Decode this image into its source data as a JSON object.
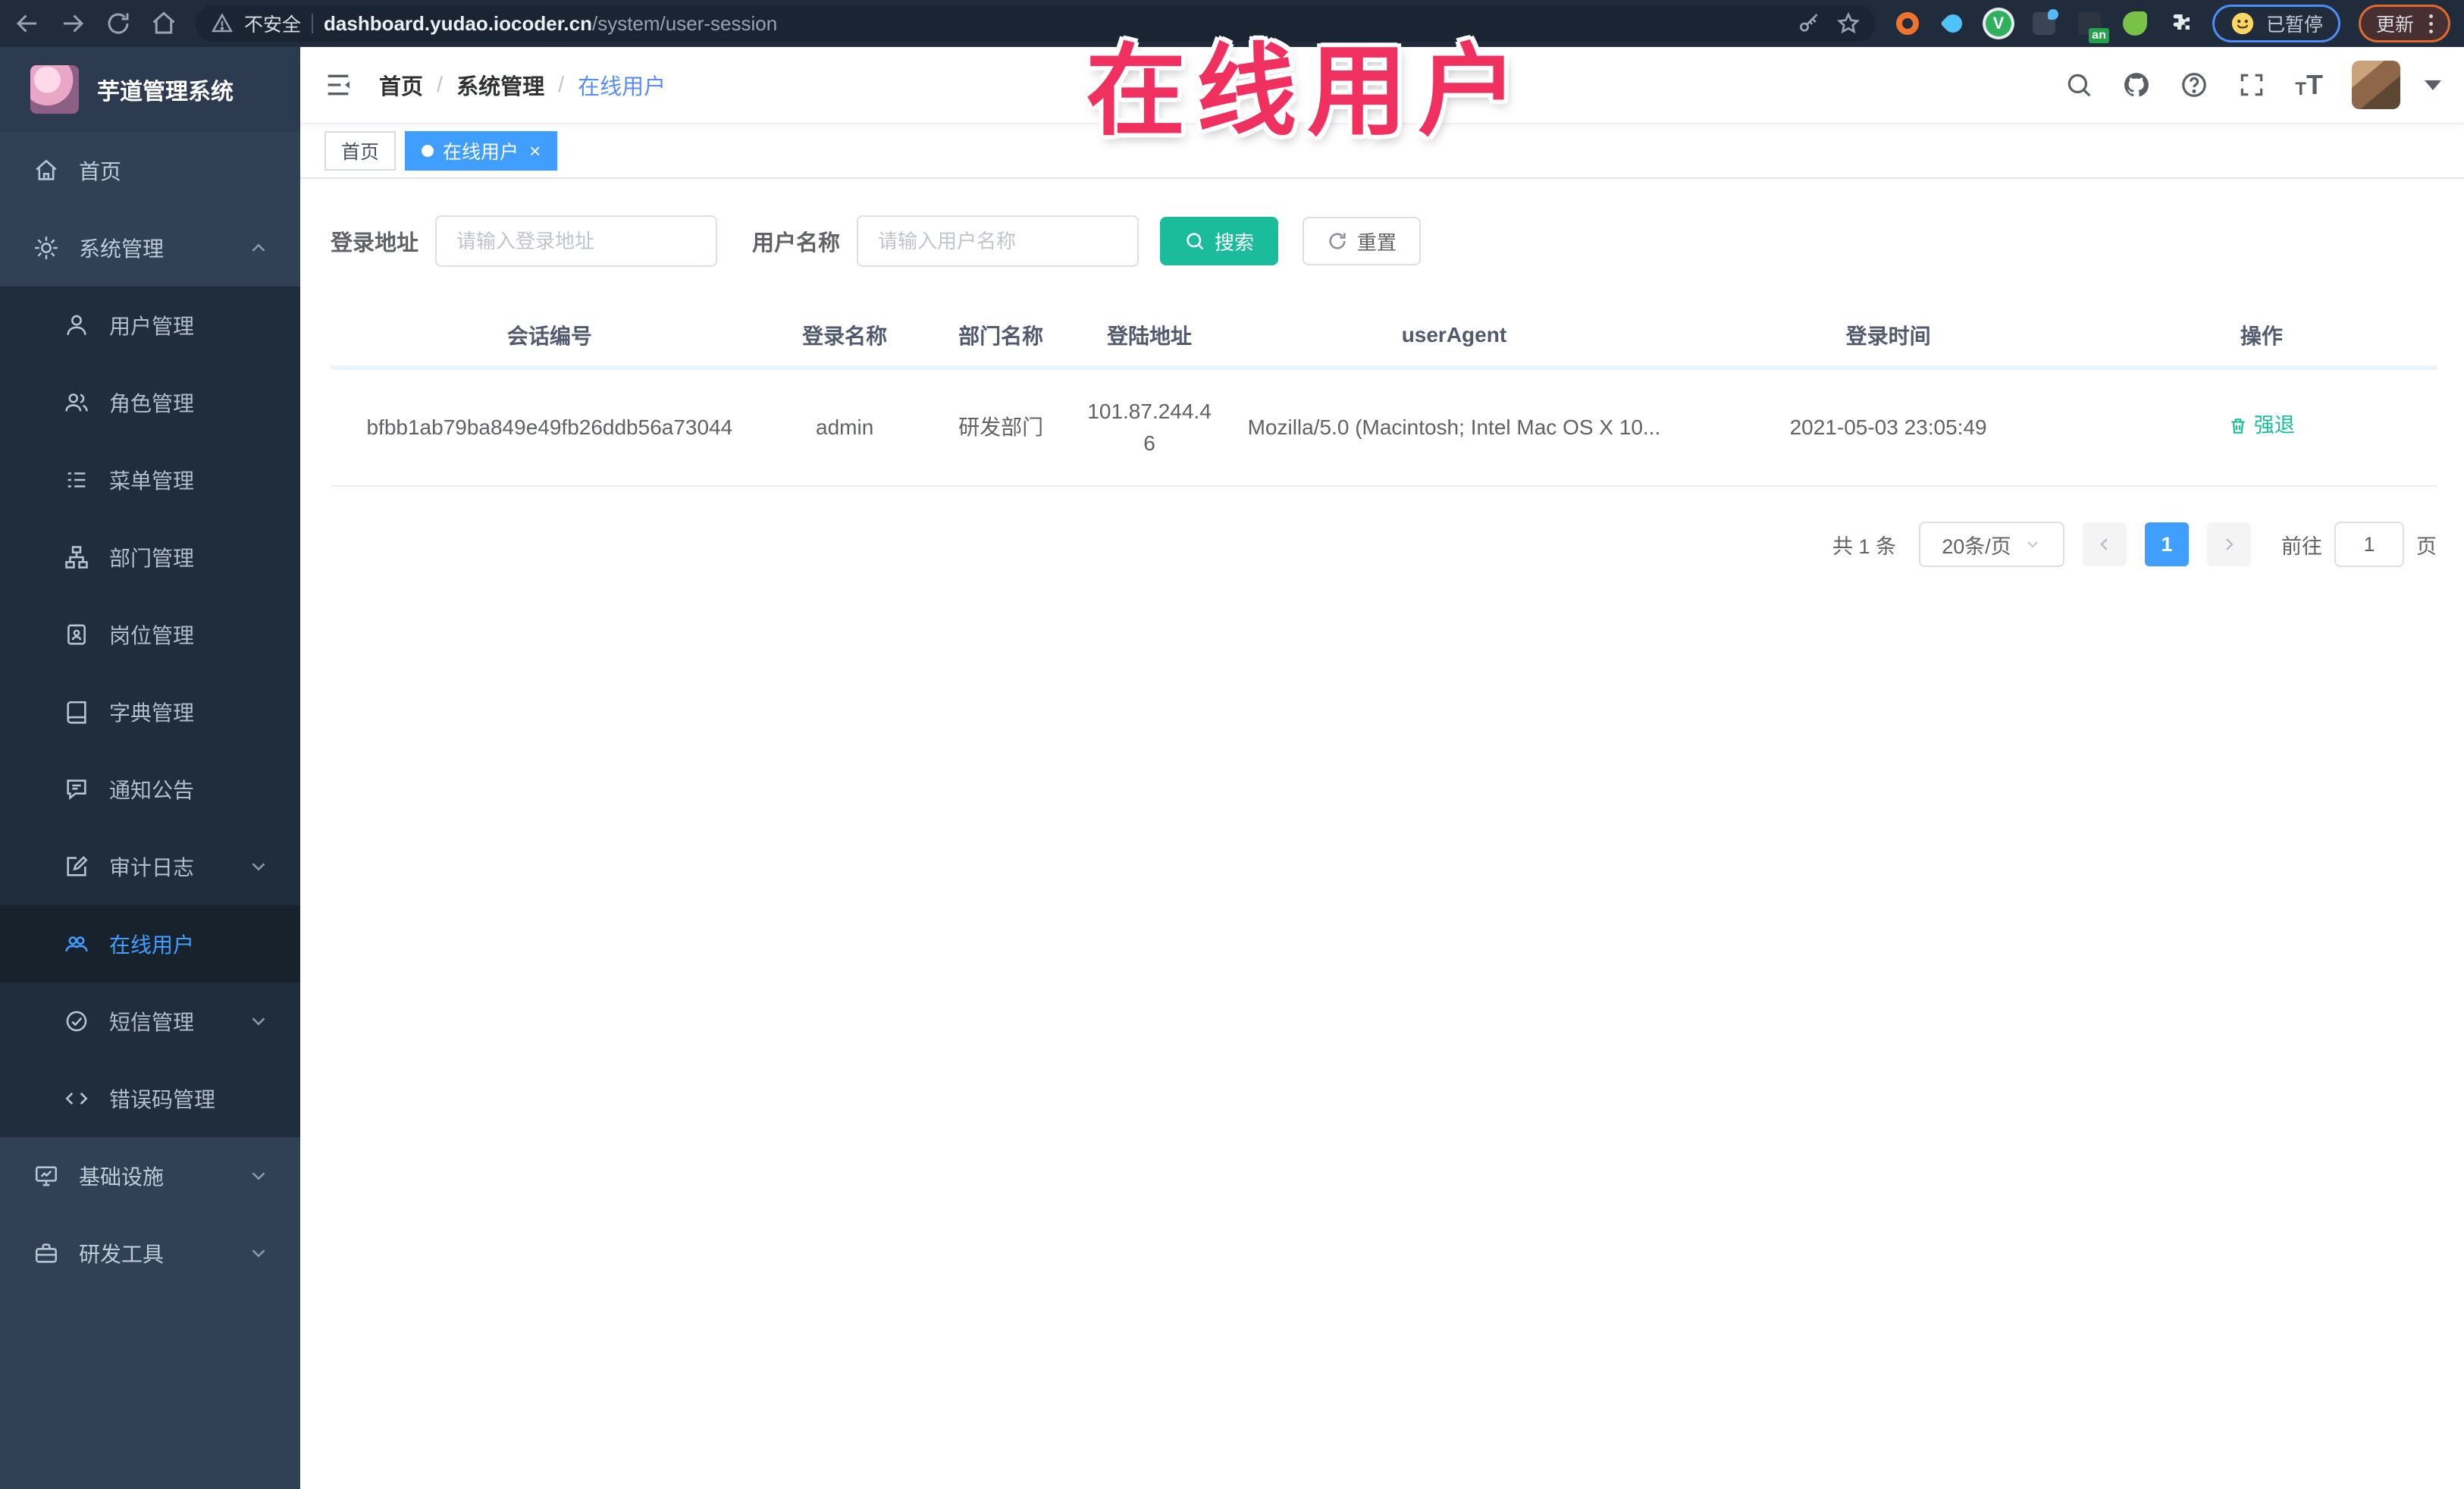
{
  "browser": {
    "security_label": "不安全",
    "url_host": "dashboard.yudao.iocoder.cn",
    "url_path": "/system/user-session",
    "paused_label": "已暂停",
    "update_label": "更新",
    "extension_badge": "an"
  },
  "overlay": {
    "title": "在线用户"
  },
  "sidebar": {
    "app_title": "芋道管理系统",
    "items": [
      {
        "label": "首页",
        "icon": "home-icon",
        "level": "top",
        "chevron": "none",
        "active": false
      },
      {
        "label": "系统管理",
        "icon": "gear-icon",
        "level": "top",
        "chevron": "up",
        "active": false
      },
      {
        "label": "用户管理",
        "icon": "user-icon",
        "level": "sub",
        "chevron": "none",
        "active": false
      },
      {
        "label": "角色管理",
        "icon": "users-icon",
        "level": "sub",
        "chevron": "none",
        "active": false
      },
      {
        "label": "菜单管理",
        "icon": "menu-list-icon",
        "level": "sub",
        "chevron": "none",
        "active": false
      },
      {
        "label": "部门管理",
        "icon": "org-tree-icon",
        "level": "sub",
        "chevron": "none",
        "active": false
      },
      {
        "label": "岗位管理",
        "icon": "id-badge-icon",
        "level": "sub",
        "chevron": "none",
        "active": false
      },
      {
        "label": "字典管理",
        "icon": "book-icon",
        "level": "sub",
        "chevron": "none",
        "active": false
      },
      {
        "label": "通知公告",
        "icon": "announcement-icon",
        "level": "sub",
        "chevron": "none",
        "active": false
      },
      {
        "label": "审计日志",
        "icon": "audit-log-icon",
        "level": "sub",
        "chevron": "down",
        "active": false
      },
      {
        "label": "在线用户",
        "icon": "online-users-icon",
        "level": "sub",
        "chevron": "none",
        "active": true
      },
      {
        "label": "短信管理",
        "icon": "sms-icon",
        "level": "sub",
        "chevron": "down",
        "active": false
      },
      {
        "label": "错误码管理",
        "icon": "code-icon",
        "level": "sub",
        "chevron": "none",
        "active": false
      },
      {
        "label": "基础设施",
        "icon": "infrastructure-icon",
        "level": "top",
        "chevron": "down",
        "active": false
      },
      {
        "label": "研发工具",
        "icon": "dev-tools-icon",
        "level": "top",
        "chevron": "down",
        "active": false
      }
    ]
  },
  "header": {
    "breadcrumb": [
      "首页",
      "系统管理",
      "在线用户"
    ],
    "separator": "/"
  },
  "tabs": [
    {
      "label": "首页",
      "active": false
    },
    {
      "label": "在线用户",
      "active": true,
      "close": "×"
    }
  ],
  "filters": {
    "login_address_label": "登录地址",
    "login_address_placeholder": "请输入登录地址",
    "user_name_label": "用户名称",
    "user_name_placeholder": "请输入用户名称",
    "search_label": "搜索",
    "reset_label": "重置"
  },
  "table": {
    "headers": [
      "会话编号",
      "登录名称",
      "部门名称",
      "登陆地址",
      "userAgent",
      "登录时间",
      "操作"
    ],
    "rows": [
      {
        "session_id": "bfbb1ab79ba849e49fb26ddb56a73044",
        "username": "admin",
        "department": "研发部门",
        "login_address": "101.87.244.46",
        "user_agent": "Mozilla/5.0 (Macintosh; Intel Mac OS X 10...",
        "login_time": "2021-05-03 23:05:49",
        "action": "强退"
      }
    ]
  },
  "pagination": {
    "total": "共 1 条",
    "page_size": "20条/页",
    "current_page": "1",
    "goto_label": "前往",
    "goto_value": "1",
    "page_unit": "页"
  },
  "colors": {
    "accent": "#409eff",
    "search_button": "#1abc9c",
    "action_link": "#1abc9c",
    "overlay_title": "#f0315f",
    "sidebar_bg": "#304156",
    "submenu_bg": "#1f2d3d"
  }
}
